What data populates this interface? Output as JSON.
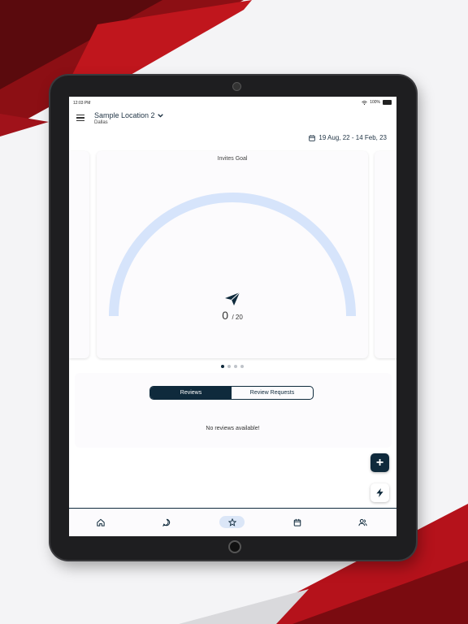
{
  "status_bar": {
    "time": "12:03 PM",
    "battery": "100%"
  },
  "header": {
    "location_name": "Sample Location 2",
    "location_city": "Dallas"
  },
  "date_range": "19 Aug, 22 - 14 Feb, 23",
  "goal_card": {
    "title": "Invites Goal",
    "current": "0",
    "total": "/ 20",
    "progress_fraction": 0
  },
  "carousel": {
    "page_count": 4,
    "active_index": 0
  },
  "tabs": [
    {
      "label": "Reviews",
      "active": true
    },
    {
      "label": "Review Requests",
      "active": false
    }
  ],
  "empty_message": "No reviews available!",
  "fab": {
    "add_symbol": "+",
    "bolt_icon": "bolt-icon"
  },
  "bottom_nav": [
    {
      "icon": "home-icon",
      "active": false
    },
    {
      "icon": "chat-icon",
      "active": false
    },
    {
      "icon": "star-icon",
      "active": true
    },
    {
      "icon": "calendar-icon",
      "active": false
    },
    {
      "icon": "users-icon",
      "active": false
    }
  ],
  "colors": {
    "primary": "#0f2a3c",
    "gauge_track": "#d6e4fb",
    "accent_red": "#b5121b",
    "nav_active": "#dbe6f7"
  }
}
